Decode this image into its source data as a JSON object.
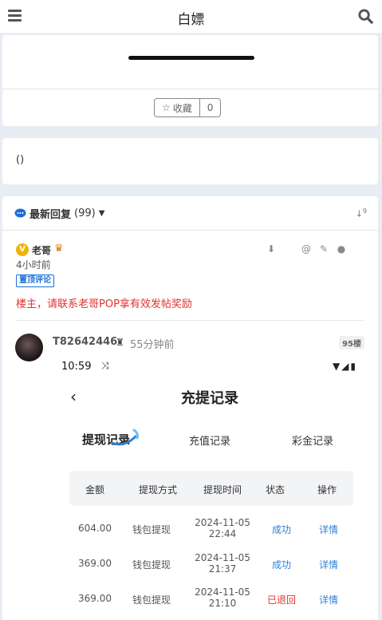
{
  "header": {
    "title": "白嫖"
  },
  "post": {
    "fav_label": "收藏",
    "fav_count": "0"
  },
  "content": {
    "text": "()"
  },
  "replies": {
    "heading": "最新回复",
    "count": "(99)",
    "items": [
      {
        "badge": "V",
        "user": "老哥",
        "time": "4小时前",
        "tag": "置顶评论",
        "text": "楼主，请联系老哥POP拿有效发帖奖励"
      },
      {
        "user": "T82642446",
        "time": "55分钟前",
        "floor": "95楼"
      }
    ]
  },
  "screenshot": {
    "status_time": "10:59",
    "page_title": "充提记录",
    "tabs": [
      "提现记录",
      "充值记录",
      "彩金记录"
    ],
    "columns": [
      "金额",
      "提现方式",
      "提现时间",
      "状态",
      "操作"
    ],
    "rows": [
      {
        "amount": "604.00",
        "method": "钱包提现",
        "date": "2024-11-05",
        "time": "22:44",
        "status": "成功",
        "action": "详情"
      },
      {
        "amount": "369.00",
        "method": "钱包提现",
        "date": "2024-11-05",
        "time": "21:37",
        "status": "成功",
        "action": "详情"
      },
      {
        "amount": "369.00",
        "method": "钱包提现",
        "date": "2024-11-05",
        "time": "21:10",
        "status": "已退回",
        "action": "详情"
      }
    ]
  },
  "colors": {
    "accent": "#1a6fd4",
    "warning": "#e0322e",
    "badge": "#f0b400"
  }
}
